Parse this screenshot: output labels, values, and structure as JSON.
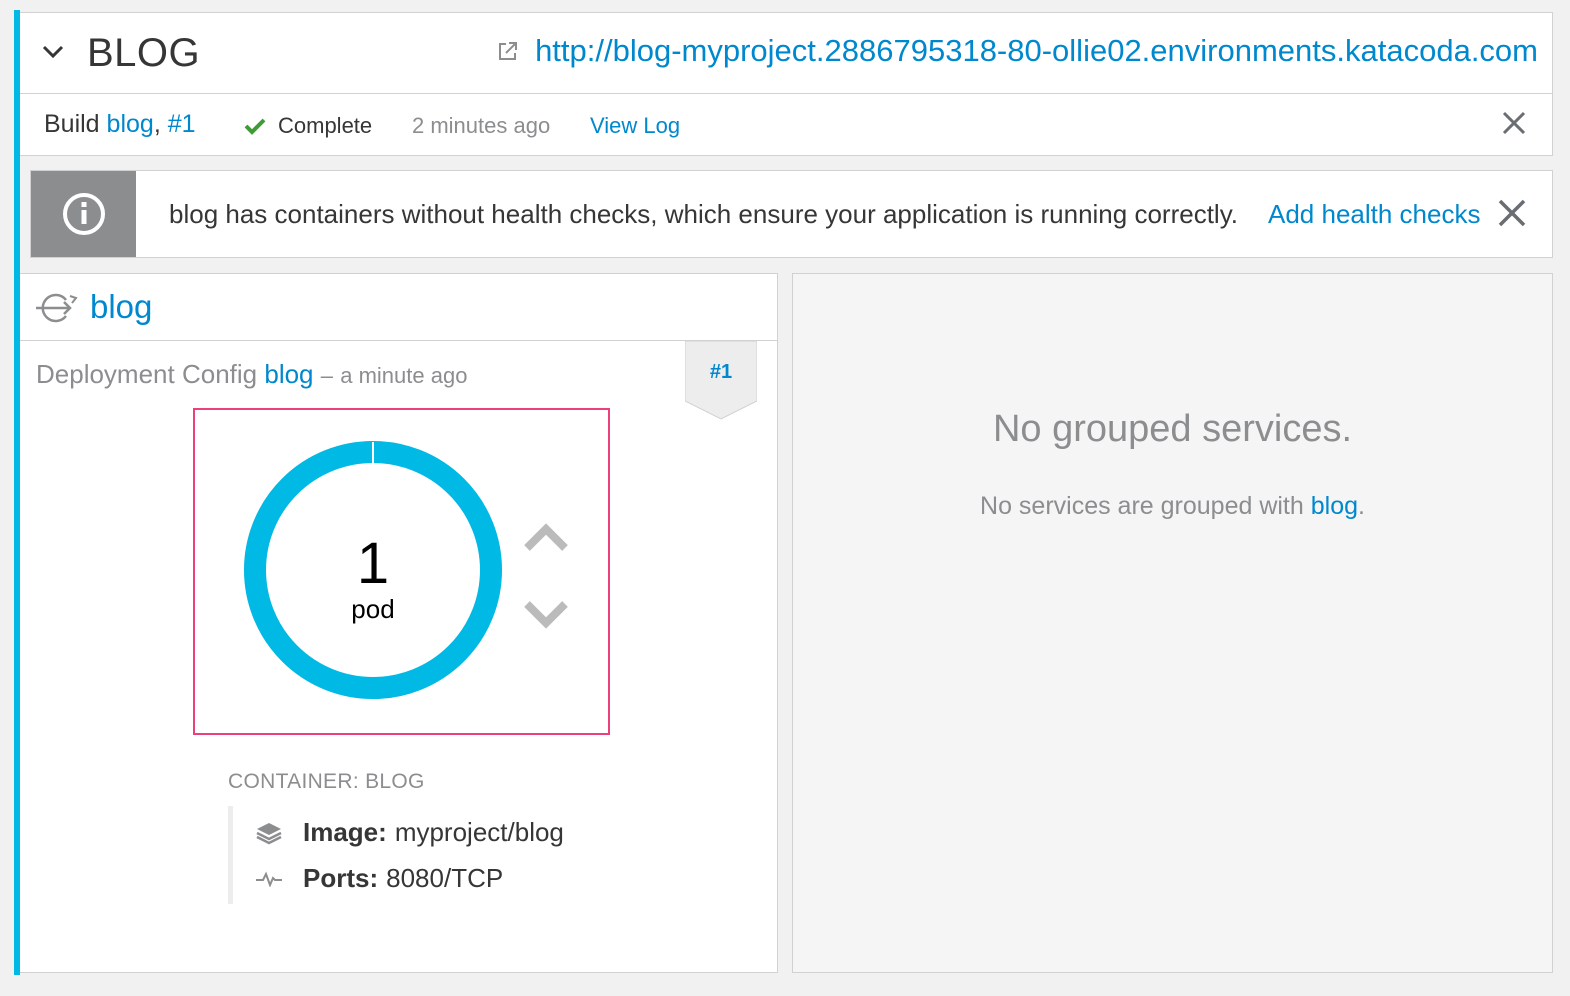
{
  "app": {
    "title": "BLOG",
    "route_url": "http://blog-myproject.2886795318-80-ollie02.environments.katacoda.com"
  },
  "build": {
    "label": "Build",
    "config_name": "blog",
    "number": "#1",
    "status": "Complete",
    "time": "2 minutes ago",
    "view_log": "View Log"
  },
  "alert": {
    "message": "blog has containers without health checks, which ensure your application is running correctly.",
    "action": "Add health checks"
  },
  "deployment": {
    "name": "blog",
    "subtitle_prefix": "Deployment Config",
    "config_link": "blog",
    "separator": "–",
    "time": "a minute ago",
    "revision": "#1",
    "pods": {
      "count": "1",
      "unit": "pod",
      "ring_color": "#00b9e4",
      "ready_fraction": 1.0
    },
    "container": {
      "label": "CONTAINER: BLOG",
      "image_key": "Image:",
      "image_value": "myproject/blog",
      "ports_key": "Ports:",
      "ports_value": "8080/TCP"
    }
  },
  "services": {
    "title": "No grouped services.",
    "subtitle_prefix": "No services are grouped with",
    "subtitle_link": "blog",
    "subtitle_suffix": "."
  },
  "icons": {
    "collapse": "chevron-down-icon",
    "external_link": "external-link-icon",
    "status": "checkmark-icon",
    "close": "close-icon",
    "info": "info-icon",
    "deployment": "deployment-config-icon",
    "image": "layers-icon",
    "ports": "pulse-icon",
    "scale_up": "chevron-up-icon",
    "scale_down": "chevron-down-icon"
  },
  "colors": {
    "accent": "#00b9e4",
    "link": "#0088ce",
    "success": "#3f9c35",
    "pod_box_border": "#ec407a"
  }
}
